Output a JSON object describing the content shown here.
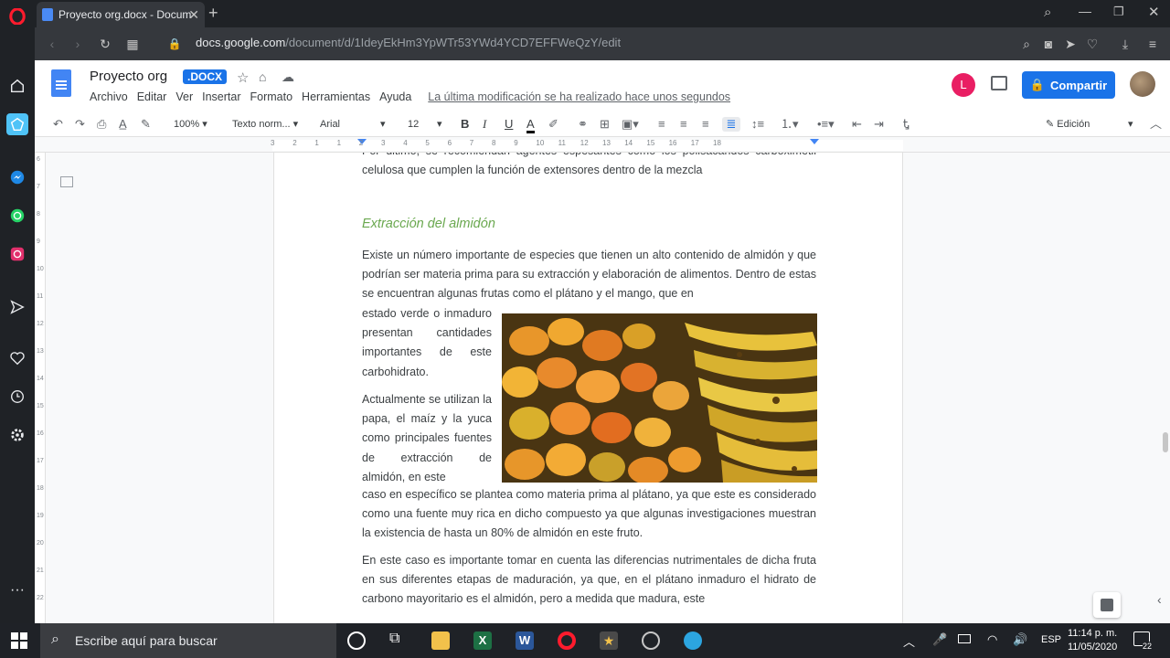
{
  "browser": {
    "tab_title": "Proyecto org.docx - Docum",
    "url_host": "docs.google.com",
    "url_path": "/document/d/1IdeyEkHm3YpWTr53YWd4YCD7EFFWeQzY/edit"
  },
  "docs": {
    "title": "Proyecto org",
    "badge": ".DOCX",
    "menu": [
      "Archivo",
      "Editar",
      "Ver",
      "Insertar",
      "Formato",
      "Herramientas",
      "Ayuda"
    ],
    "last_edit": "La última modificación se ha realizado hace unos segundos",
    "avatar_letter": "L",
    "share_label": "Compartir",
    "mode_label": "Edición"
  },
  "toolbar": {
    "zoom": "100%",
    "style": "Texto norm...",
    "font": "Arial",
    "size": "12"
  },
  "ruler": {
    "numbers": [
      "3",
      "2",
      "1",
      "1",
      "2",
      "3",
      "4",
      "5",
      "6",
      "7",
      "8",
      "9",
      "10",
      "11",
      "12",
      "13",
      "14",
      "15",
      "16",
      "17",
      "18"
    ]
  },
  "vruler": {
    "numbers": [
      "6",
      "7",
      "8",
      "9",
      "10",
      "11",
      "12",
      "13",
      "14",
      "15",
      "16",
      "17",
      "18",
      "19",
      "20",
      "21",
      "22"
    ]
  },
  "document": {
    "top_para": "Por último, se recomiendan agentes espesantes como los polisacáridos carboximetil celulosa que cumplen la función de extensores dentro de la mezcla",
    "heading": "Extracción del almidón",
    "para1_top": "Existe un número importante de especies que tienen un alto contenido de almidón y que podrían ser materia prima para su extracción y elaboración de alimentos. Dentro de estas se encuentran algunas frutas como el plátano y el mango, que en",
    "para1_wrap": "estado verde o inmaduro presentan cantidades importantes de este carbohidrato.",
    "para2_wrap": "Actualmente se utilizan la papa, el maíz y la yuca como principales fuentes de extracción de almidón, en este",
    "para2_rest": "caso en específico se plantea como materia prima al plátano, ya que este es considerado como una fuente muy rica en dicho compuesto ya que algunas investigaciones muestran la existencia de hasta un 80% de almidón en este fruto.",
    "para3": "En este caso es importante tomar en cuenta las diferencias nutrimentales de dicha fruta en sus diferentes etapas de maduración, ya que, en el plátano inmaduro el hidrato de carbono mayoritario es el almidón, pero a medida que madura, este"
  },
  "taskbar": {
    "search_placeholder": "Escribe aquí para buscar",
    "lang": "ESP",
    "time": "11:14 p. m.",
    "date": "11/05/2020",
    "notif_count": "22"
  }
}
